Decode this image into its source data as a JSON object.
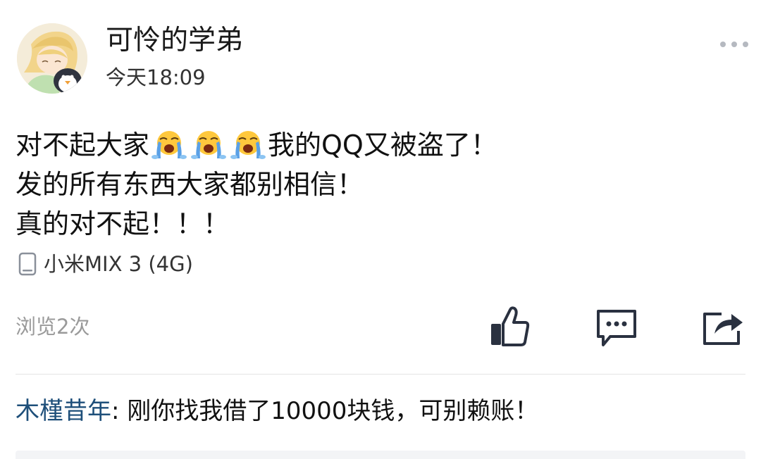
{
  "post": {
    "author": "可怜的学弟",
    "time": "今天18:09",
    "lines": [
      {
        "before": "对不起大家",
        "emoji": [
          "crying-face-icon",
          "crying-face-icon",
          "crying-face-icon"
        ],
        "after": "我的QQ又被盗了！"
      },
      {
        "text": "发的所有东西大家都别相信！"
      },
      {
        "text": "真的对不起！！！"
      }
    ],
    "device": "小米MIX 3 (4G)",
    "views": "浏览2次"
  },
  "actions": {
    "like_icon": "thumbs-up-icon",
    "comment_icon": "comment-bubble-icon",
    "share_icon": "share-icon",
    "more_icon": "more-dots-icon"
  },
  "comments": [
    {
      "author": "木槿昔年",
      "separator": ": ",
      "text": "刚你找我借了10000块钱，可别赖账！"
    }
  ],
  "colors": {
    "text": "#111111",
    "secondary": "#333333",
    "muted": "#9a9a9a",
    "link": "#1e4f7a",
    "icon_dark": "#2a3140",
    "emoji_yellow": "#ffc83d",
    "tears_blue": "#5aa0e6"
  }
}
